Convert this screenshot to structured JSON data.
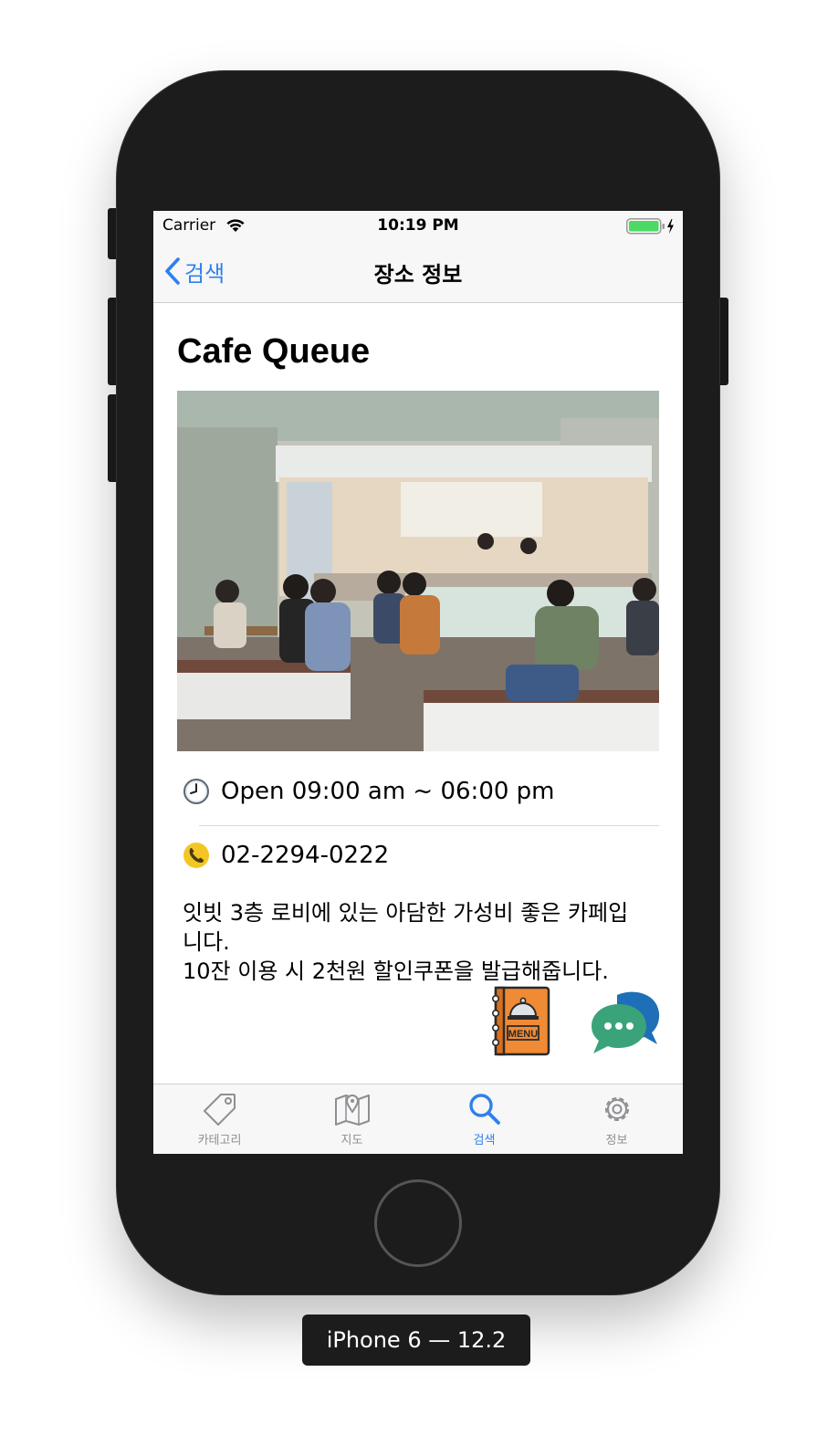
{
  "status_bar": {
    "carrier": "Carrier",
    "time": "10:19 PM",
    "wifi_icon": "wifi-icon",
    "battery_icon": "battery-charging-icon"
  },
  "nav_bar": {
    "back_label": "검색",
    "title": "장소 정보"
  },
  "place": {
    "name": "Cafe Queue",
    "hours": "Open 09:00 am ~ 06:00 pm",
    "phone": "02-2294-0222",
    "description_lines": [
      "잇빗 3층 로비에 있는 아담한 가성비 좋은 카페입",
      "니다.",
      "10잔 이용 시 2천원 할인쿠폰을 발급해줍니다."
    ],
    "menu_icon_text": "MENU"
  },
  "tab_bar": {
    "items": [
      {
        "label": "카테고리",
        "icon": "tag-icon",
        "active": false
      },
      {
        "label": "지도",
        "icon": "map-icon",
        "active": false
      },
      {
        "label": "검색",
        "icon": "search-icon",
        "active": true
      },
      {
        "label": "정보",
        "icon": "gear-icon",
        "active": false
      }
    ]
  },
  "device_label": "iPhone 6 — 12.2",
  "colors": {
    "accent": "#2f80ed",
    "inactive_tab": "#8e8e93",
    "bar_background": "#f7f7f7",
    "menu_orange": "#f08a35",
    "chat_green": "#3aa37a",
    "chat_blue": "#1e6fb8"
  }
}
